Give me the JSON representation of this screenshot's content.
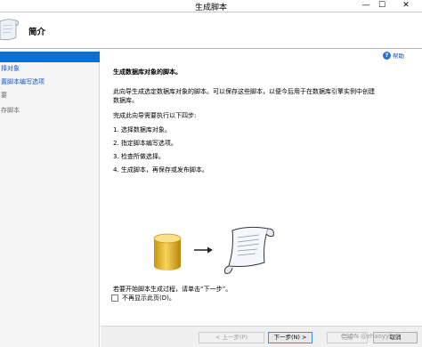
{
  "window": {
    "title": "生成脚本",
    "minimize_glyph": "—",
    "maximize_glyph": "☐",
    "close_glyph": "✕"
  },
  "header": {
    "title": "简介",
    "icon": "scroll-wizard-icon"
  },
  "sidebar": {
    "items": [
      {
        "label": "",
        "state": "selected"
      },
      {
        "label": "择对象",
        "state": "link"
      },
      {
        "label": "置脚本编写选项",
        "state": "link"
      },
      {
        "label": "要",
        "state": "grey"
      },
      {
        "label": "存脚本",
        "state": "grey"
      }
    ]
  },
  "content": {
    "help_label": "帮助",
    "heading": "生成数据库对象的脚本。",
    "intro_line1": "此向导生成选定数据库对象的脚本。可以保存这些脚本，以便今后用于在数据库引擎实例中创建",
    "intro_line2": "数据库。",
    "steps_intro": "完成此向导需要执行以下四步:",
    "steps": [
      "1. 选择数据库对象。",
      "2. 指定脚本编写选项。",
      "3. 检查所做选择。",
      "4. 生成脚本，再保存或发布脚本。"
    ],
    "start_prompt": "若要开始脚本生成过程，请单击“下一步”。",
    "checkbox_label": "不再显示此页(D)。",
    "checkbox_checked": false
  },
  "footer": {
    "prev_label": "< 上一步(P)",
    "next_label": "下一步(N) >",
    "finish_label": "完成",
    "cancel_label": "取消",
    "watermark": "CSDN @zhaoyylink"
  },
  "colors": {
    "selection": "#0b6fd4",
    "link": "#1a55c9",
    "db_gold": "#f0c23a"
  }
}
